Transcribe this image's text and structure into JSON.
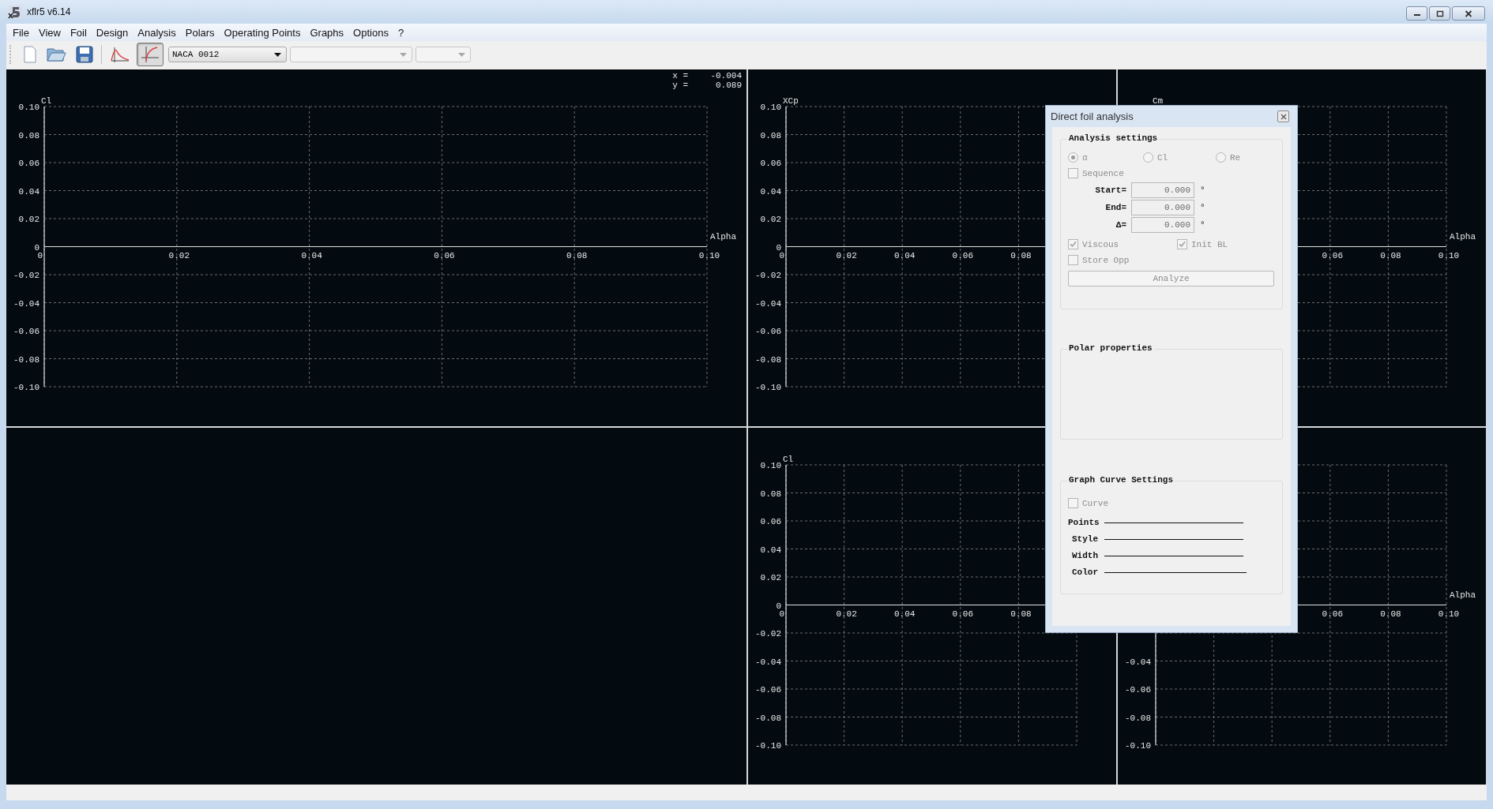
{
  "window": {
    "title": "xflr5 v6.14"
  },
  "menu": [
    "File",
    "View",
    "Foil",
    "Design",
    "Analysis",
    "Polars",
    "Operating Points",
    "Graphs",
    "Options",
    "?"
  ],
  "toolbar": {
    "view_toggles": [
      {
        "selected": false
      },
      {
        "selected": true
      }
    ],
    "combos": [
      {
        "value": "NACA 0012",
        "disabled": false
      },
      {
        "disabled": true
      },
      {
        "disabled": true
      }
    ]
  },
  "graphs": [
    {
      "cursor": [
        {
          "label": "x =",
          "value": "-0.004"
        },
        {
          "label": "y =",
          "value": "0.089"
        }
      ],
      "chart_data": {
        "type": "line",
        "grid": true,
        "xlabel": "Alpha",
        "ylabel": "Cl",
        "xlim": [
          0,
          0.1
        ],
        "ylim": [
          -0.1,
          0.1
        ],
        "xticks": [
          {
            "value": 0,
            "label": "0"
          },
          {
            "value": 0.02,
            "label": "0.02"
          },
          {
            "value": 0.04,
            "label": "0.04"
          },
          {
            "value": 0.06,
            "label": "0.06"
          },
          {
            "value": 0.08,
            "label": "0.08"
          },
          {
            "value": 0.1,
            "label": "0.10"
          }
        ],
        "yticks": [
          {
            "value": 0.1,
            "label": "0.10"
          },
          {
            "value": 0.08,
            "label": "0.08"
          },
          {
            "value": 0.06,
            "label": "0.06"
          },
          {
            "value": 0.04,
            "label": "0.04"
          },
          {
            "value": 0.02,
            "label": "0.02"
          },
          {
            "value": 0,
            "label": "0"
          },
          {
            "value": -0.02,
            "label": "-0.02"
          },
          {
            "value": -0.04,
            "label": "-0.04"
          },
          {
            "value": -0.06,
            "label": "-0.06"
          },
          {
            "value": -0.08,
            "label": "-0.08"
          },
          {
            "value": -0.1,
            "label": "-0.10"
          }
        ]
      }
    },
    {
      "chart_data": {
        "type": "line",
        "grid": true,
        "ylabel": "XCp",
        "xlim": [
          0,
          0.1
        ],
        "ylim": [
          -0.1,
          0.1
        ],
        "xticks": [
          {
            "value": 0,
            "label": "0"
          },
          {
            "value": 0.02,
            "label": "0.02"
          },
          {
            "value": 0.04,
            "label": "0.04"
          },
          {
            "value": 0.06,
            "label": "0.06"
          },
          {
            "value": 0.08,
            "label": "0.08"
          }
        ],
        "yticks": [
          {
            "value": 0.1,
            "label": "0.10"
          },
          {
            "value": 0.08,
            "label": "0.08"
          },
          {
            "value": 0.06,
            "label": "0.06"
          },
          {
            "value": 0.04,
            "label": "0.04"
          },
          {
            "value": 0.02,
            "label": "0.02"
          },
          {
            "value": 0,
            "label": "0"
          },
          {
            "value": -0.02,
            "label": "-0.02"
          },
          {
            "value": -0.04,
            "label": "-0.04"
          },
          {
            "value": -0.06,
            "label": "-0.06"
          },
          {
            "value": -0.08,
            "label": "-0.08"
          },
          {
            "value": -0.1,
            "label": "-0.10"
          }
        ]
      }
    },
    {
      "chart_data": {
        "type": "line",
        "xlabel": "Alpha",
        "ylabel": "Cm",
        "xlim": [
          0,
          0.1
        ],
        "ylim": [
          -0.1,
          0.1
        ],
        "grid": true,
        "xticks": [
          {
            "value": 0.06,
            "label": "0.06"
          },
          {
            "value": 0.08,
            "label": "0.08"
          },
          {
            "value": 0.1,
            "label": "0.10"
          }
        ]
      }
    },
    {
      "chart_data": {
        "type": "line",
        "grid": true,
        "ylabel": "Cl",
        "xlim": [
          0,
          0.1
        ],
        "ylim": [
          -0.1,
          0.1
        ],
        "xticks": [
          {
            "value": 0,
            "label": "0"
          },
          {
            "value": 0.02,
            "label": "0.02"
          },
          {
            "value": 0.04,
            "label": "0.04"
          },
          {
            "value": 0.06,
            "label": "0.06"
          },
          {
            "value": 0.08,
            "label": "0.08"
          }
        ],
        "yticks": [
          {
            "value": 0.1,
            "label": "0.10"
          },
          {
            "value": 0.08,
            "label": "0.08"
          },
          {
            "value": 0.06,
            "label": "0.06"
          },
          {
            "value": 0.04,
            "label": "0.04"
          },
          {
            "value": 0.02,
            "label": "0.02"
          },
          {
            "value": 0,
            "label": "0"
          },
          {
            "value": -0.02,
            "label": "-0.02"
          },
          {
            "value": -0.04,
            "label": "-0.04"
          },
          {
            "value": -0.06,
            "label": "-0.06"
          },
          {
            "value": -0.08,
            "label": "-0.08"
          },
          {
            "value": -0.1,
            "label": "-0.10"
          }
        ]
      }
    },
    {
      "chart_data": {
        "type": "line",
        "grid": true,
        "xlabel": "Alpha",
        "xlim": [
          0,
          0.1
        ],
        "ylim": [
          -0.1,
          0.1
        ],
        "xticks": [
          {
            "value": 0.06,
            "label": "0.06"
          },
          {
            "value": 0.08,
            "label": "0.08"
          },
          {
            "value": 0.1,
            "label": "0.10"
          }
        ],
        "yticks": [
          {
            "value": -0.04,
            "label": "-0.04"
          },
          {
            "value": -0.06,
            "label": "-0.06"
          },
          {
            "value": -0.08,
            "label": "-0.08"
          },
          {
            "value": -0.1,
            "label": "-0.10"
          }
        ]
      }
    }
  ],
  "dialog": {
    "title": "Direct foil analysis",
    "analysis_settings": {
      "title": "Analysis settings",
      "modes": [
        {
          "label": "α",
          "selected": true,
          "disabled": true
        },
        {
          "label": "Cl",
          "selected": false,
          "disabled": true
        },
        {
          "label": "Re",
          "selected": false,
          "disabled": true
        }
      ],
      "sequence": {
        "label": "Sequence",
        "checked": false,
        "disabled": true
      },
      "fields": [
        {
          "label": "Start=",
          "value": "0.000",
          "unit": "°",
          "disabled": true
        },
        {
          "label": "End=",
          "value": "0.000",
          "unit": "°",
          "disabled": true
        },
        {
          "label": "Δ=",
          "value": "0.000",
          "unit": "°",
          "disabled": true
        }
      ],
      "options": [
        {
          "label": "Viscous",
          "checked": true,
          "disabled": true
        },
        {
          "label": "Init BL",
          "checked": true,
          "disabled": true
        },
        {
          "label": "Store Opp",
          "checked": false,
          "disabled": true
        }
      ],
      "analyze_button": {
        "label": "Analyze",
        "disabled": true
      }
    },
    "polar_properties": {
      "title": "Polar properties"
    },
    "curve_settings": {
      "title": "Graph Curve Settings",
      "curve": {
        "label": "Curve",
        "checked": false,
        "disabled": true
      },
      "rows": [
        {
          "label": "Points"
        },
        {
          "label": "Style"
        },
        {
          "label": "Width"
        },
        {
          "label": "Color"
        }
      ]
    }
  }
}
